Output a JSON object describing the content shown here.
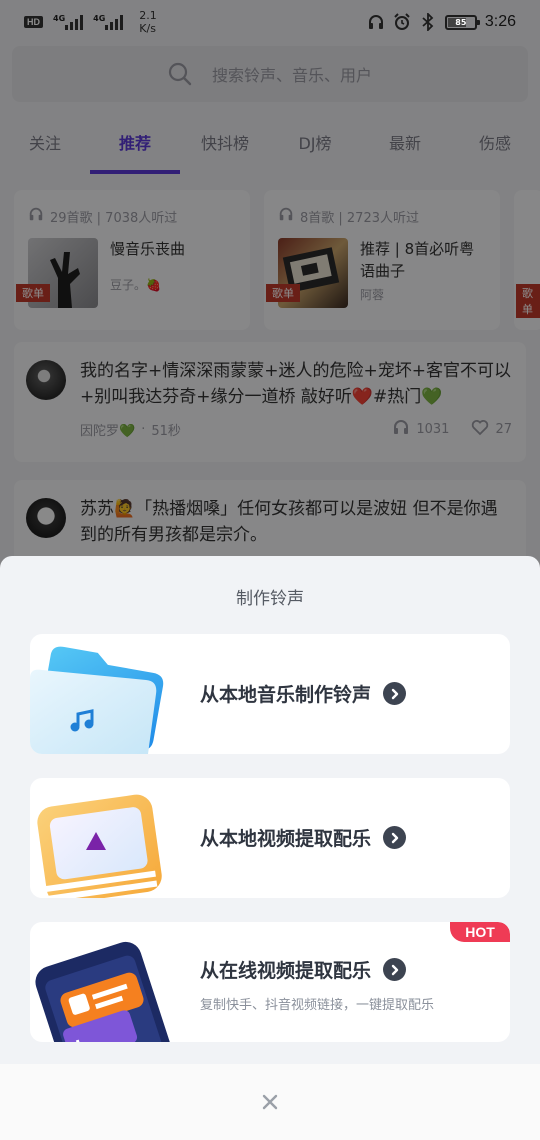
{
  "status_bar": {
    "hd": "HD",
    "signal_1": "4G",
    "signal_2": "4G",
    "speed_value": "2.1",
    "speed_unit": "K/s",
    "battery": "85",
    "time": "3:26"
  },
  "search": {
    "placeholder": "搜索铃声、音乐、用户"
  },
  "tabs": [
    {
      "label": "关注",
      "active": false
    },
    {
      "label": "推荐",
      "active": true
    },
    {
      "label": "快抖榜",
      "active": false
    },
    {
      "label": "DJ榜",
      "active": false
    },
    {
      "label": "最新",
      "active": false
    },
    {
      "label": "伤感",
      "active": false
    }
  ],
  "playlists": [
    {
      "meta": "29首歌 | 7038人听过",
      "title": "慢音乐丧曲",
      "author": "豆子。🍓",
      "tag": "歌单"
    },
    {
      "meta": "8首歌 | 2723人听过",
      "title": "推荐 | 8首必听粤语曲子",
      "author": "阿蓉",
      "tag": "歌单"
    },
    {
      "tag": "歌单"
    }
  ],
  "feed": [
    {
      "text": "我的名字+情深深雨蒙蒙+迷人的危险+宠坏+客官不可以+别叫我达芬奇+缘分一道桥 敲好听❤️#热门💚",
      "author": "因陀罗💚",
      "time": "51秒",
      "listens": "1031",
      "likes": "27"
    },
    {
      "text": "苏苏🙋「热播烟嗓」任何女孩都可以是波妞 但不是你遇到的所有男孩都是宗介。"
    }
  ],
  "sheet": {
    "title": "制作铃声",
    "options": [
      {
        "label": "从本地音乐制作铃声",
        "subtitle": ""
      },
      {
        "label": "从本地视频提取配乐",
        "subtitle": ""
      },
      {
        "label": "从在线视频提取配乐",
        "subtitle": "复制快手、抖音视频链接，一键提取配乐",
        "badge": "HOT"
      }
    ]
  },
  "colors": {
    "accent": "#5b3ad8",
    "hot_badge": "#ef3b55",
    "tag": "#c0392b"
  }
}
